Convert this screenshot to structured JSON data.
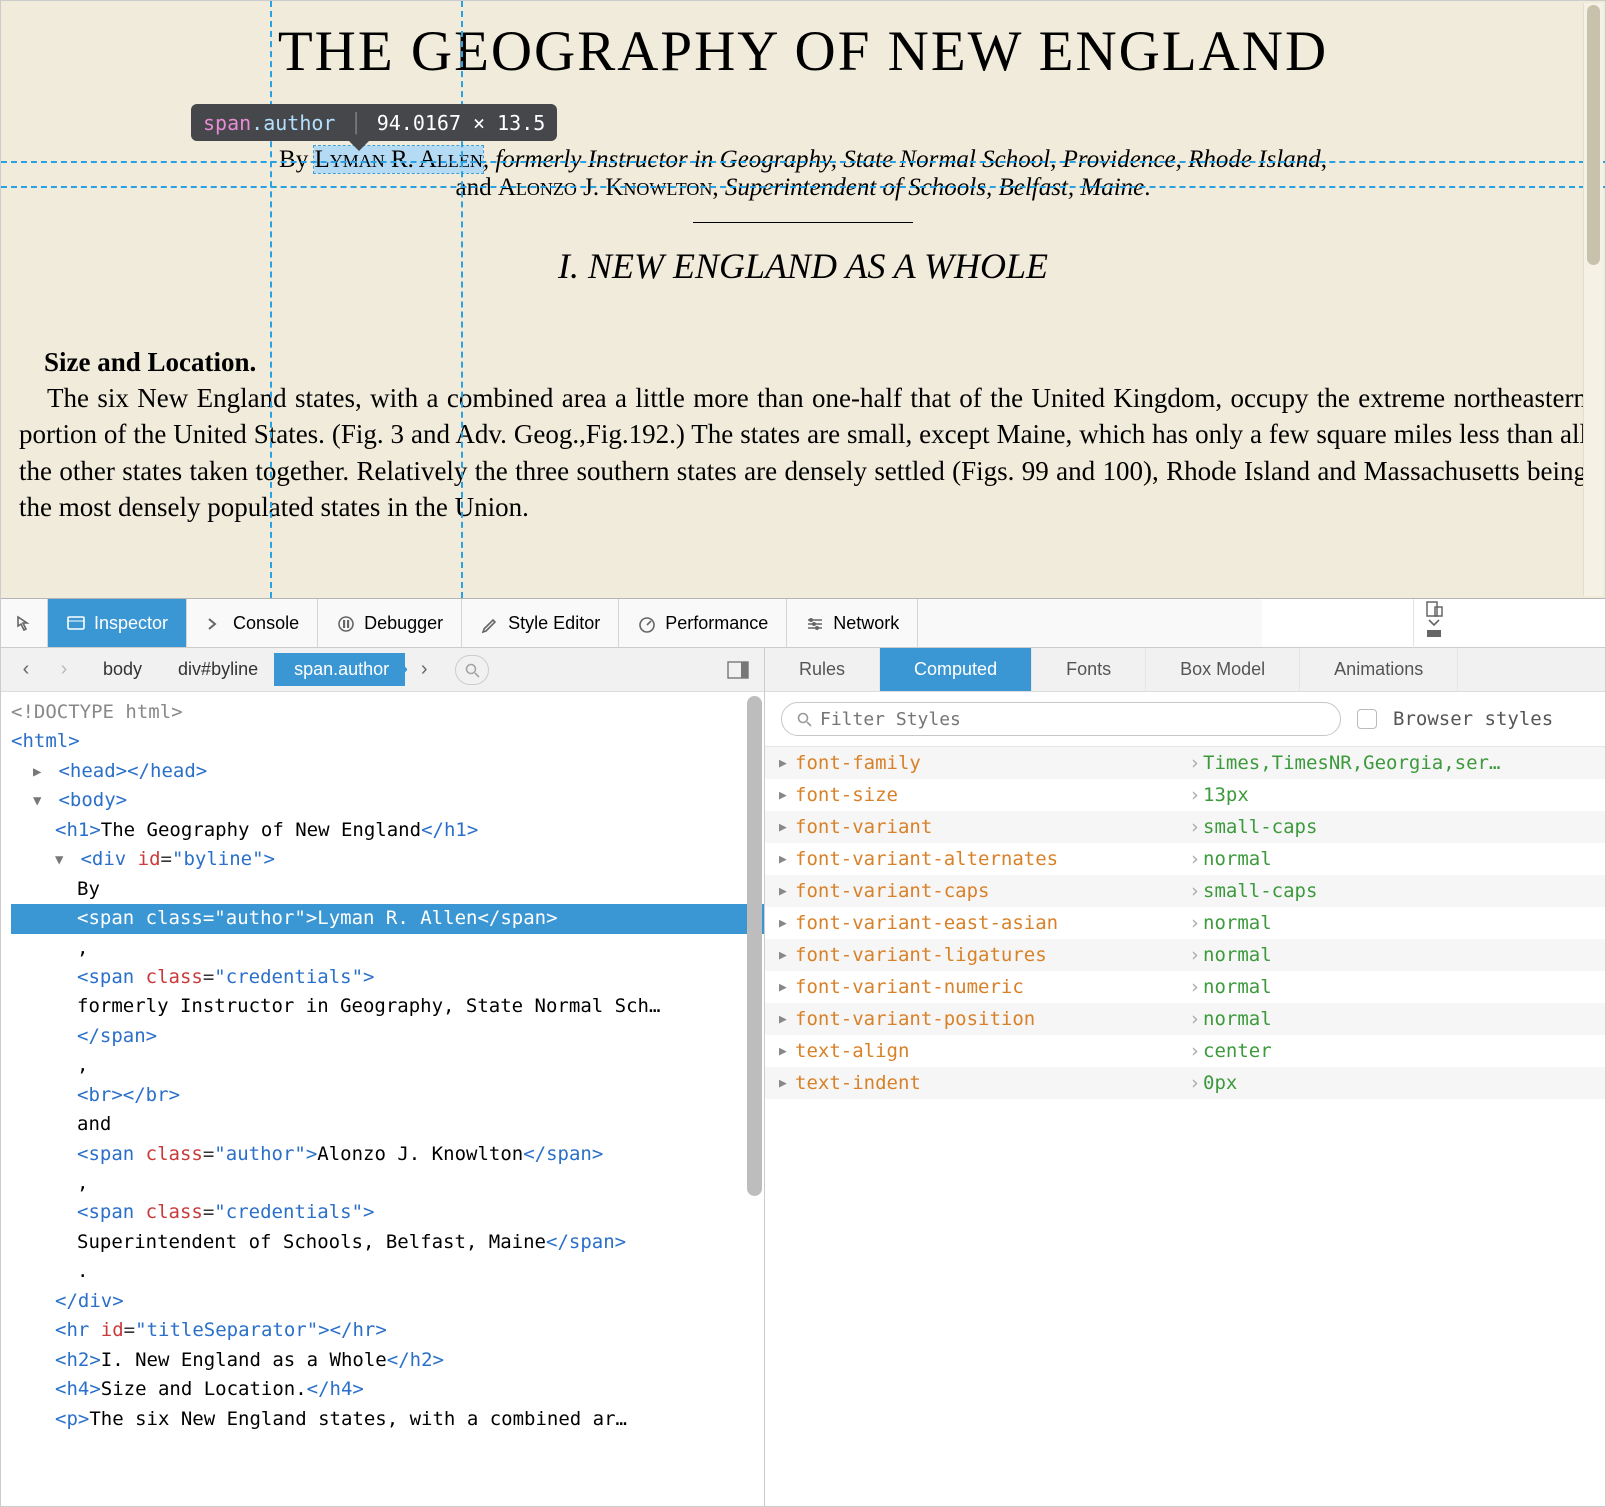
{
  "page": {
    "title": "THE GEOGRAPHY OF NEW ENGLAND",
    "byline": {
      "by": "By ",
      "author1": "Lyman R. Allen",
      "comma1": ", ",
      "cred1": "formerly Instructor in Geography, State Normal School, Providence, Rhode Island",
      "comma2": ",",
      "and": "and ",
      "author2": "Alonzo J. Knowlton",
      "comma3": ", ",
      "cred2": "Superintendent of Schools, Belfast, Maine",
      "period": "."
    },
    "h2": "I. NEW ENGLAND AS A WHOLE",
    "h4": "Size and Location.",
    "para": "The six New England states, with a combined area a little more than one-half that of the United Kingdom, occupy the extreme northeastern portion of the United States. (Fig. 3 and Adv. Geog.,Fig.192.) The states are small, except Maine, which has only a few square miles less than all the other states taken together. Relatively the three southern states are densely settled (Figs. 99 and 100), Rhode Island and Massachusetts being the most densely populated states in the Union."
  },
  "tooltip": {
    "tag": "span",
    "cls": ".author",
    "dims": "94.0167 × 13.5"
  },
  "toolbar": {
    "inspector": "Inspector",
    "console": "Console",
    "debugger": "Debugger",
    "style_editor": "Style Editor",
    "performance": "Performance",
    "network": "Network"
  },
  "crumbs": {
    "c1": "body",
    "c2": "div#byline",
    "c3": "span.author"
  },
  "dom": {
    "doctype": "<!DOCTYPE html>",
    "html_open": "html",
    "head": "head",
    "body": "body",
    "h1_text": "The Geography of New England",
    "div_id": "byline",
    "by": "By",
    "author_class": "author",
    "author1_text": "Lyman R. Allen",
    "comma": ",",
    "cred_class": "credentials",
    "cred1_text": "formerly Instructor in Geography, State Normal Sch…",
    "br": "br",
    "and": "and",
    "author2_text": "Alonzo J. Knowlton",
    "cred2_text": "Superintendent of Schools, Belfast, Maine",
    "period": ".",
    "hr_id": "titleSeparator",
    "h2_text": "I. New England as a Whole",
    "h4_text": "Size and Location.",
    "p_text": "The six New England states, with a combined ar…"
  },
  "rtabs": {
    "rules": "Rules",
    "computed": "Computed",
    "fonts": "Fonts",
    "box": "Box Model",
    "anim": "Animations"
  },
  "filter": {
    "placeholder": "Filter Styles",
    "label": "Browser styles"
  },
  "computed": [
    {
      "prop": "font-family",
      "val": "Times,TimesNR,Georgia,ser…"
    },
    {
      "prop": "font-size",
      "val": "13px"
    },
    {
      "prop": "font-variant",
      "val": "small-caps"
    },
    {
      "prop": "font-variant-alternates",
      "val": "normal"
    },
    {
      "prop": "font-variant-caps",
      "val": "small-caps"
    },
    {
      "prop": "font-variant-east-asian",
      "val": "normal"
    },
    {
      "prop": "font-variant-ligatures",
      "val": "normal"
    },
    {
      "prop": "font-variant-numeric",
      "val": "normal"
    },
    {
      "prop": "font-variant-position",
      "val": "normal"
    },
    {
      "prop": "text-align",
      "val": "center"
    },
    {
      "prop": "text-indent",
      "val": "0px"
    }
  ]
}
